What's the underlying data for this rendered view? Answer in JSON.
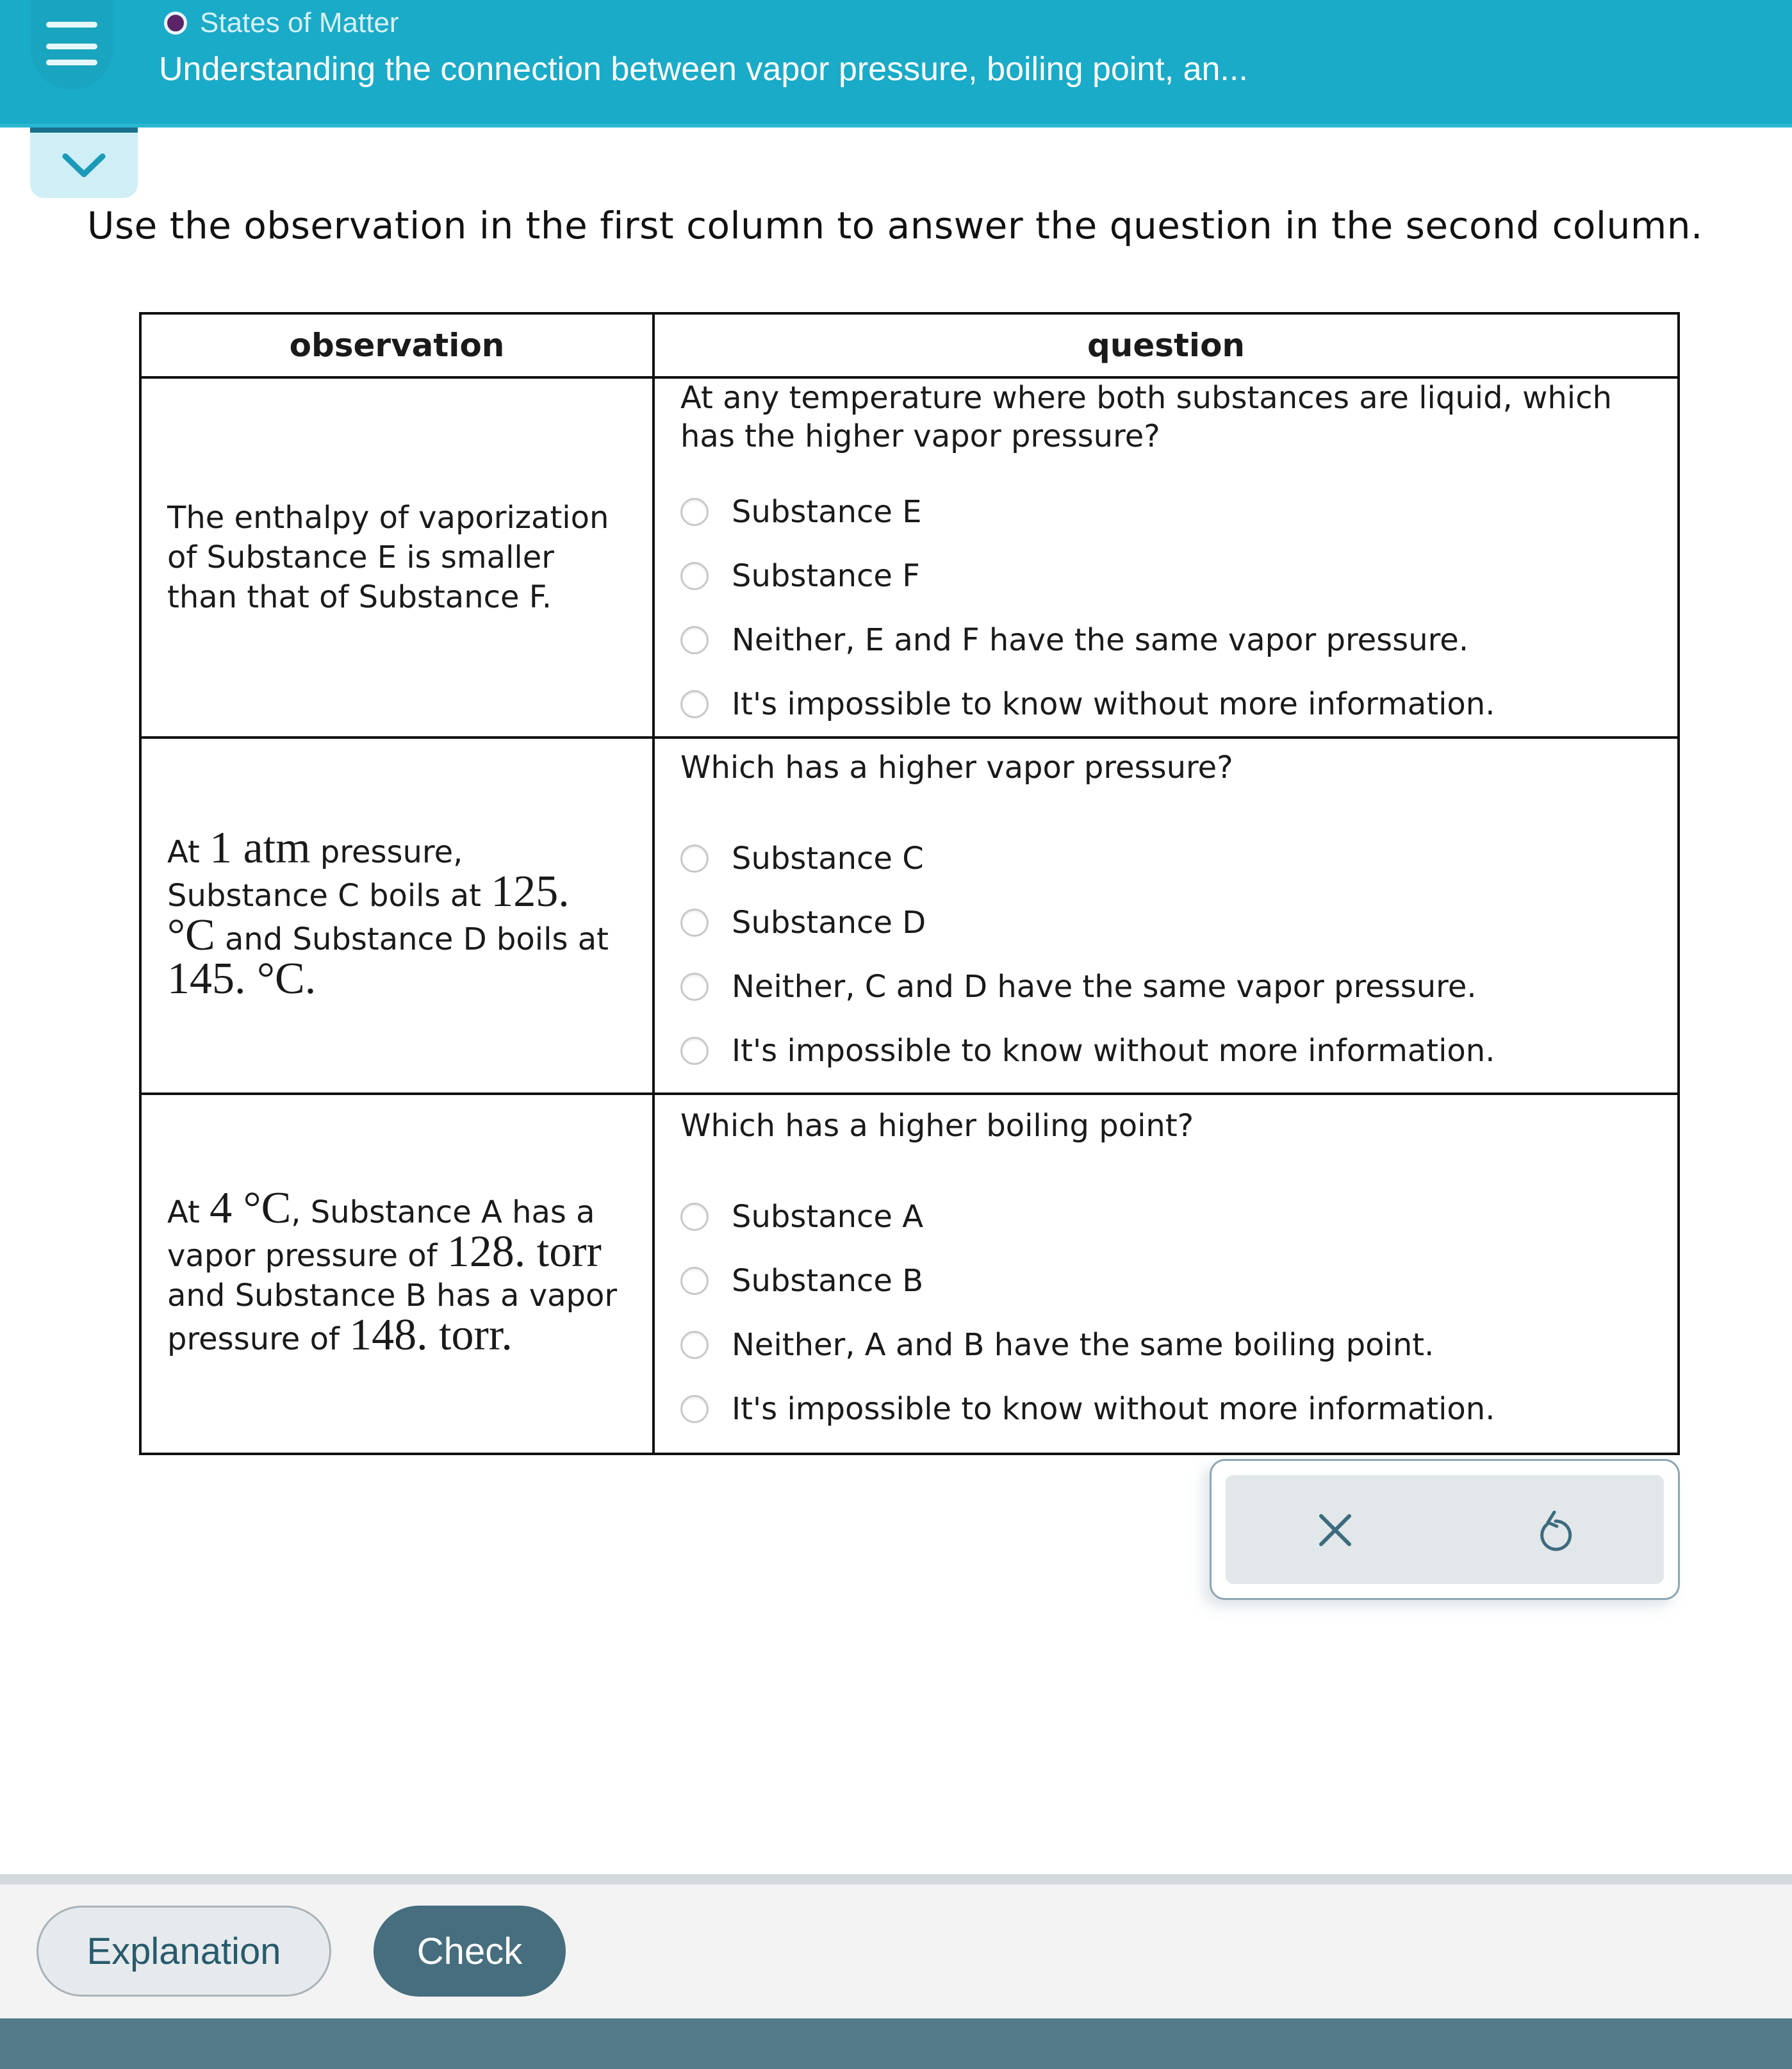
{
  "header": {
    "topic": "States of Matter",
    "title": "Understanding the connection between vapor pressure, boiling point, an...",
    "topic_dot_color": "#5a2466",
    "bar_color": "#1aabc8"
  },
  "instruction": "Use the observation in the first column to answer the question in the second column.",
  "table": {
    "headers": {
      "observation": "observation",
      "question": "question"
    },
    "rows": [
      {
        "observation": {
          "parts": [
            "The enthalpy of vaporization of Substance E is smaller than that of Substance F."
          ]
        },
        "question": "At any temperature where both substances are liquid, which has the higher vapor pressure?",
        "options": [
          "Substance E",
          "Substance F",
          "Neither, E and F have the same vapor pressure.",
          "It's impossible to know without more information."
        ]
      },
      {
        "observation": {
          "t1": "At ",
          "m1": "1 atm",
          "t2": " pressure, Substance C boils at ",
          "m2": "125. °C",
          "t3": " and Substance D boils at ",
          "m3": "145. °C",
          "t4": "."
        },
        "question": "Which has a higher vapor pressure?",
        "options": [
          "Substance C",
          "Substance D",
          "Neither, C and D have the same vapor pressure.",
          "It's impossible to know without more information."
        ]
      },
      {
        "observation": {
          "t1": "At ",
          "m1": "4 °C",
          "t2": ", Substance A has a vapor pressure of ",
          "m2": "128. torr",
          "t3": " and Substance B has a vapor pressure of ",
          "m3": "148. torr",
          "t4": "."
        },
        "question": "Which has a higher boiling point?",
        "options": [
          "Substance A",
          "Substance B",
          "Neither, A and B have the same boiling point.",
          "It's impossible to know without more information."
        ]
      }
    ]
  },
  "actions": {
    "clear_icon": "x-icon",
    "undo_icon": "undo-icon"
  },
  "footer": {
    "explanation_label": "Explanation",
    "check_label": "Check"
  }
}
